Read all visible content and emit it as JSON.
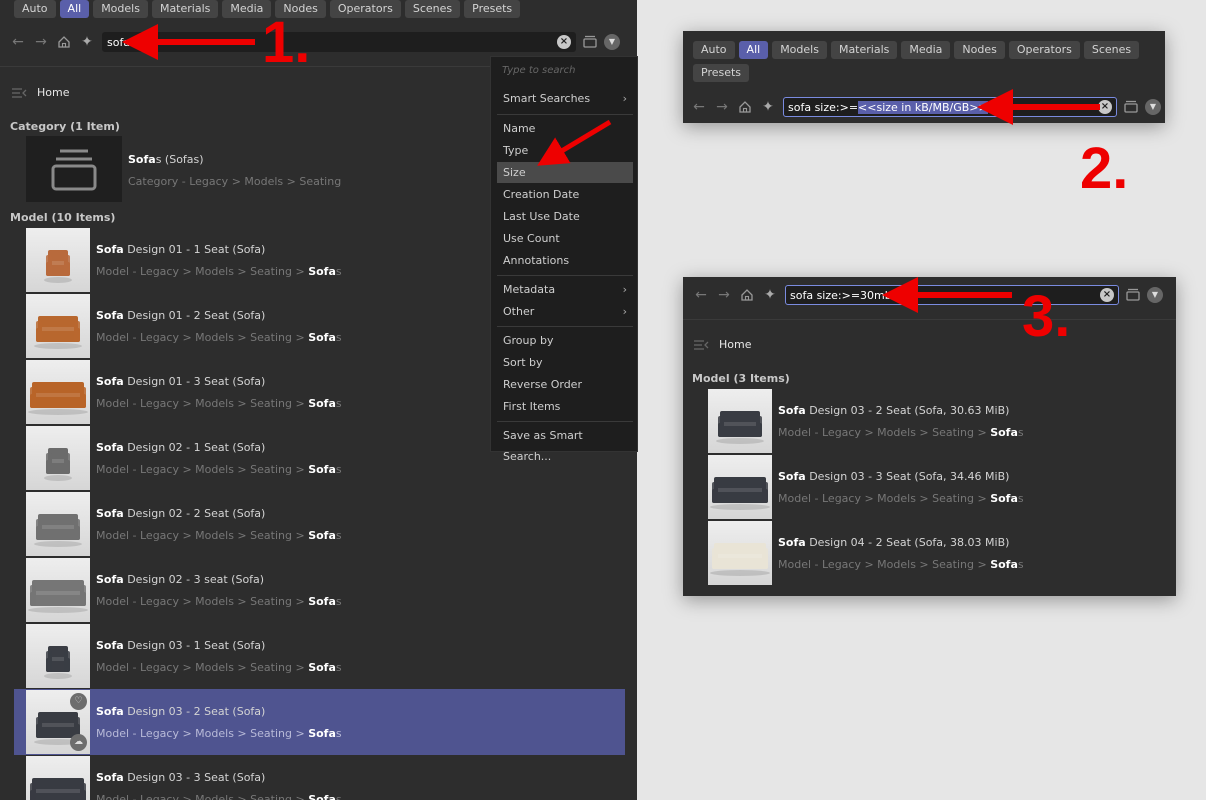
{
  "filter_chips": [
    "Auto",
    "All",
    "Models",
    "Materials",
    "Media",
    "Nodes",
    "Operators",
    "Scenes",
    "Presets"
  ],
  "active_chip": "All",
  "main": {
    "search_value": "sofa",
    "home_label": "Home",
    "category_section_title": "Category (1 Item)",
    "category_item": {
      "name_bold": "Sofa",
      "name_rest": "s (Sofas)",
      "path": "Category - Legacy > Models > Seating"
    },
    "model_section_title": "Model (10 Items)",
    "path_prefix": "Model - Legacy > Models > Seating > ",
    "path_bold": "Sofa",
    "path_suffix": "s",
    "items": [
      {
        "bold": "Sofa",
        "rest": " Design 01 - 1 Seat (Sofa)",
        "color": "#b86a3c",
        "kind": "armchair"
      },
      {
        "bold": "Sofa",
        "rest": " Design 01 - 2 Seat (Sofa)",
        "color": "#b8672e",
        "kind": "sofa2"
      },
      {
        "bold": "Sofa",
        "rest": " Design 01 - 3 Seat (Sofa)",
        "color": "#b86428",
        "kind": "sofa3"
      },
      {
        "bold": "Sofa",
        "rest": " Design 02 - 1 Seat (Sofa)",
        "color": "#6b6b6b",
        "kind": "armchair"
      },
      {
        "bold": "Sofa",
        "rest": " Design 02 - 2 Seat (Sofa)",
        "color": "#707070",
        "kind": "sofa2"
      },
      {
        "bold": "Sofa",
        "rest": " Design 02 - 3 seat (Sofa)",
        "color": "#767676",
        "kind": "sofa3"
      },
      {
        "bold": "Sofa",
        "rest": " Design 03 - 1 Seat (Sofa)",
        "color": "#3a3d44",
        "kind": "armchair"
      },
      {
        "bold": "Sofa",
        "rest": " Design 03 - 2 Seat (Sofa)",
        "color": "#393c43",
        "kind": "sofa2",
        "selected": true
      },
      {
        "bold": "Sofa",
        "rest": " Design 03 - 3 Seat (Sofa)",
        "color": "#383b42",
        "kind": "sofa3"
      }
    ]
  },
  "menu": {
    "placeholder": "Type to search",
    "items": [
      "Smart Searches",
      "Name",
      "Type",
      "Size",
      "Creation Date",
      "Last Use Date",
      "Use Count",
      "Annotations",
      "Metadata",
      "Other",
      "Group by",
      "Sort by",
      "Reverse Order",
      "First Items",
      "Save as Smart Search..."
    ],
    "highlighted": "Size"
  },
  "panel2": {
    "search_prefix": "sofa size:>=",
    "search_selected": "<<size in kB/MB/GB>>"
  },
  "panel3": {
    "search_value": "sofa size:>=30mb",
    "home_label": "Home",
    "section_title": "Model (3 Items)",
    "items": [
      {
        "bold": "Sofa",
        "rest": " Design 03 - 2 Seat (Sofa, 30.63 MiB)",
        "color": "#393c43",
        "kind": "sofa2"
      },
      {
        "bold": "Sofa",
        "rest": " Design 03 - 3 Seat (Sofa, 34.46 MiB)",
        "color": "#383b42",
        "kind": "sofa3"
      },
      {
        "bold": "Sofa",
        "rest": " Design 04 - 2 Seat (Sofa, 38.03 MiB)",
        "color": "#e9e4d6",
        "kind": "chesterfield"
      }
    ]
  },
  "step_labels": [
    "1.",
    "2.",
    "3."
  ],
  "colors": {
    "accent": "#5a5faa",
    "selected_row": "#4f5490",
    "annotation": "#ee0000",
    "panel_bg": "#2d2d2d"
  }
}
